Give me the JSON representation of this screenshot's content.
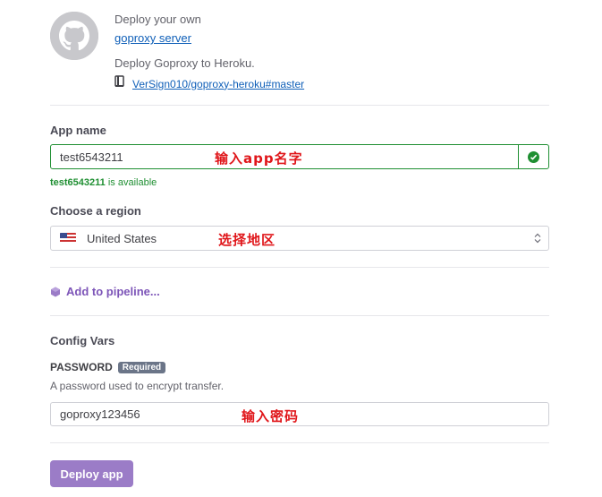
{
  "repo": {
    "deploy_prefix": "Deploy your own",
    "app_link": "goproxy server",
    "description": "Deploy Goproxy to Heroku.",
    "repo_link": "VerSign010/goproxy-heroku#master"
  },
  "app_name": {
    "label": "App name",
    "value": "test6543211",
    "availability_name": "test6543211",
    "availability_suffix": "is available",
    "annotation": "输入app名字"
  },
  "region": {
    "label": "Choose a region",
    "selected": "United States",
    "annotation": "选择地区"
  },
  "pipeline": {
    "label": "Add to pipeline..."
  },
  "config_vars": {
    "heading": "Config Vars",
    "var_name": "PASSWORD",
    "badge": "Required",
    "help": "A password used to encrypt transfer.",
    "value": "goproxy123456",
    "annotation": "输入密码"
  },
  "actions": {
    "deploy_label": "Deploy app"
  },
  "colors": {
    "link": "#0f5fb8",
    "success": "#1f8f32",
    "accent": "#9b7cc7",
    "annotation": "#e0161a"
  }
}
